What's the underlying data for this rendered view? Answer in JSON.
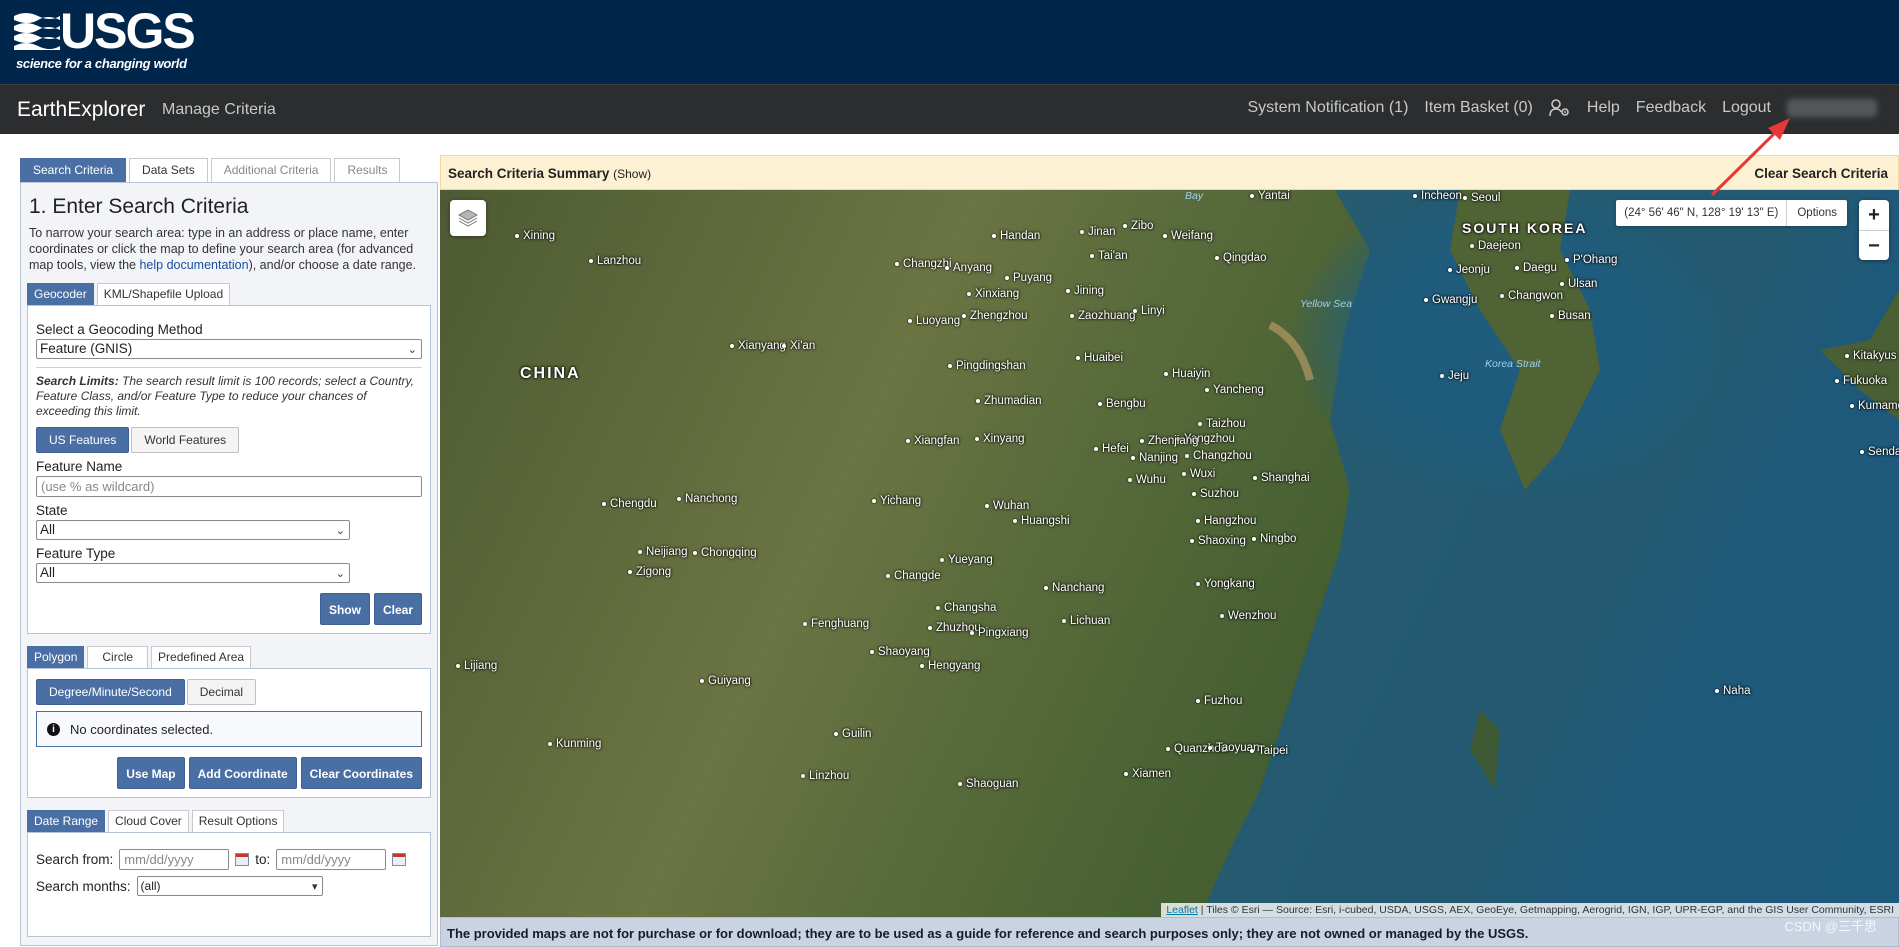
{
  "banner": {
    "logo_text": "USGS",
    "tagline": "science for a changing world"
  },
  "navbar": {
    "brand": "EarthExplorer",
    "manage_criteria": "Manage Criteria",
    "system_notification": "System Notification (1)",
    "item_basket": "Item Basket (0)",
    "help": "Help",
    "feedback": "Feedback",
    "logout": "Logout"
  },
  "left_tabs": [
    "Search Criteria",
    "Data Sets",
    "Additional Criteria",
    "Results"
  ],
  "criteria": {
    "title": "1. Enter Search Criteria",
    "intro_before": "To narrow your search area: type in an address or place name, enter coordinates or click the map to define your search area (for advanced map tools, view the ",
    "intro_link": "help documentation",
    "intro_after": "), and/or choose a date range.",
    "geo_tabs": [
      "Geocoder",
      "KML/Shapefile Upload"
    ],
    "method_label": "Select a Geocoding Method",
    "method_value": "Feature (GNIS)",
    "limits_bold": "Search Limits:",
    "limits_text": " The search result limit is 100 records; select a Country, Feature Class, and/or Feature Type to reduce your chances of exceeding this limit.",
    "feature_tabs": [
      "US Features",
      "World Features"
    ],
    "feature_name_label": "Feature Name",
    "feature_name_placeholder": "(use % as wildcard)",
    "state_label": "State",
    "state_value": "All",
    "type_label": "Feature Type",
    "type_value": "All",
    "show_btn": "Show",
    "clear_btn": "Clear"
  },
  "area": {
    "tabs": [
      "Polygon",
      "Circle",
      "Predefined Area"
    ],
    "format_tabs": [
      "Degree/Minute/Second",
      "Decimal"
    ],
    "notice": "No coordinates selected.",
    "use_map": "Use Map",
    "add_coord": "Add Coordinate",
    "clear_coords": "Clear Coordinates"
  },
  "date": {
    "tabs": [
      "Date Range",
      "Cloud Cover",
      "Result Options"
    ],
    "from_label": "Search from:",
    "from_placeholder": "mm/dd/yyyy",
    "to_label": "to:",
    "to_placeholder": "mm/dd/yyyy",
    "months_label": "Search months:",
    "months_value": "(all)"
  },
  "map": {
    "summary_title": "Search Criteria Summary",
    "summary_show": "(Show)",
    "clear_criteria": "Clear Search Criteria",
    "coordinates": "(24° 56' 46\" N, 128° 19' 13\" E)",
    "options": "Options",
    "zoom_in": "+",
    "zoom_out": "−",
    "attribution_link": "Leaflet",
    "attribution_text": " | Tiles © Esri — Source: Esri, i-cubed, USDA, USGS, AEX, GeoEye, Getmapping, Aerogrid, IGN, IGP, UPR-EGP, and the GIS User Community, ESRI",
    "disclaimer": "The provided maps are not for purchase or for download; they are to be used as a guide for reference and search purposes only; they are not owned or managed by the USGS.",
    "labels": {
      "china": "CHINA",
      "south_korea": "SOUTH KOREA",
      "bay": "Bay",
      "yellow_sea": "Yellow Sea",
      "korea_strait": "Korea Strait",
      "xining": "Xining",
      "lanzhou": "Lanzhou",
      "xianyang": "Xianyang",
      "xian": "Xi'an",
      "chengdu": "Chengdu",
      "nanchong": "Nanchong",
      "neijiang": "Neijiang",
      "zigong": "Zigong",
      "chongqing": "Chongqing",
      "lijiang": "Lijiang",
      "guiyang": "Guiyang",
      "kunming": "Kunming",
      "changzhi": "Changzhi",
      "anyang": "Anyang",
      "handan": "Handan",
      "puyang": "Puyang",
      "xinxiang": "Xinxiang",
      "luoyang": "Luoyang",
      "zhengzhou": "Zhengzhou",
      "pingdingshan": "Pingdingshan",
      "zhumadian": "Zhumadian",
      "xiangfan": "Xiangfan",
      "xinyang": "Xinyang",
      "yichang": "Yichang",
      "wuhan": "Wuhan",
      "huangshi": "Huangshi",
      "changde": "Changde",
      "yueyang": "Yueyang",
      "changsha": "Changsha",
      "zhuzhou": "Zhuzhou",
      "pingxiang": "Pingxiang",
      "shaoyang": "Shaoyang",
      "hengyang": "Hengyang",
      "fenghuang": "Fenghuang",
      "guilin": "Guilin",
      "linzhou": "Linzhou",
      "shaoguan": "Shaoguan",
      "jinan": "Jinan",
      "zibo": "Zibo",
      "weifang": "Weifang",
      "taian": "Tai'an",
      "qingdao": "Qingdao",
      "jining": "Jining",
      "zaozhuang": "Zaozhuang",
      "linyi": "Linyi",
      "huaibei": "Huaibei",
      "huaiyin": "Huaiyin",
      "bengbu": "Bengbu",
      "yancheng": "Yancheng",
      "taizhou": "Taizhou",
      "yangzhou": "Yangzhou",
      "zhenjiang": "Zhenjiang",
      "nanjing": "Nanjing",
      "hefei": "Hefei",
      "changzhou": "Changzhou",
      "wuxi": "Wuxi",
      "wuhu": "Wuhu",
      "suzhou": "Suzhou",
      "shanghai": "Shanghai",
      "hangzhou": "Hangzhou",
      "shaoxing": "Shaoxing",
      "ningbo": "Ningbo",
      "nanchang": "Nanchang",
      "yongkang": "Yongkang",
      "lichuan": "Lichuan",
      "wenzhou": "Wenzhou",
      "fuzhou": "Fuzhou",
      "quanzhou": "Quanzhou",
      "taoyuan": "Taoyuan",
      "taipei": "Taipei",
      "xiamen": "Xiamen",
      "yantai": "Yantai",
      "incheon": "Incheon",
      "seoul": "Seoul",
      "daejeon": "Daejeon",
      "jeonju": "Jeonju",
      "daegu": "Daegu",
      "pohang": "P'Ohang",
      "gwangju": "Gwangju",
      "changwon": "Changwon",
      "ulsan": "Ulsan",
      "busan": "Busan",
      "jeju": "Jeju",
      "kitakyushu": "Kitakyus",
      "fukuoka": "Fukuoka",
      "kumamoto": "Kumamo",
      "sendai": "Sendai",
      "naha": "Naha"
    }
  },
  "watermark": "CSDN @三千思",
  "colors": {
    "banner": "#00264c",
    "navbar": "#2b2d2f",
    "accent": "#4a6fa5",
    "summary": "#fdf1d3"
  }
}
